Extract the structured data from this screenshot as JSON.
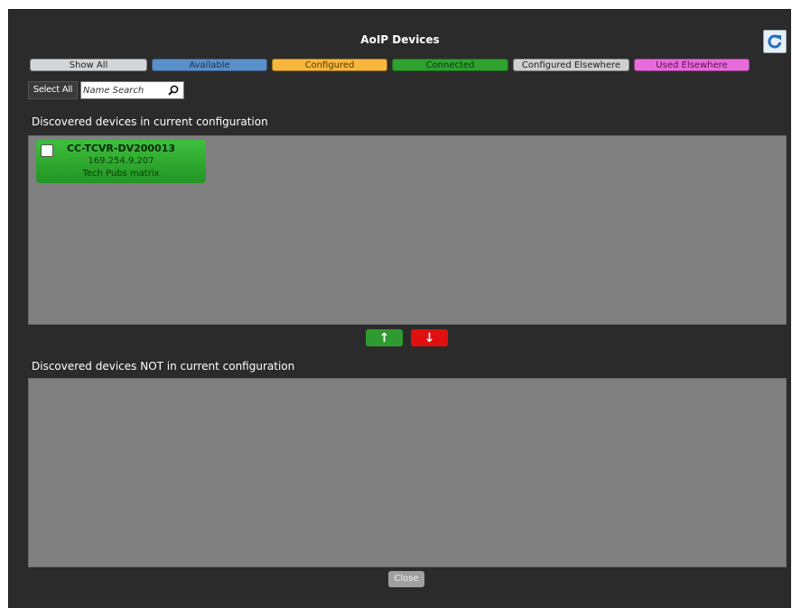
{
  "window": {
    "title": "AoIP Devices"
  },
  "filters": {
    "show_all": "Show All",
    "available": "Available",
    "configured": "Configured",
    "connected": "Connected",
    "configured_elsewhere": "Configured Elsewhere",
    "used_elsewhere": "Used Elsewhere"
  },
  "toolbar": {
    "select_all": "Select All",
    "search_placeholder": "Name Search"
  },
  "sections": {
    "current": "Discovered devices in current configuration",
    "not_current": "Discovered devices NOT in current configuration"
  },
  "devices_current": [
    {
      "name": "CC-TCVR-DV200013",
      "ip": "169.254.9.207",
      "description": "Tech Pubs matrix",
      "status": "Connected",
      "checked": false
    }
  ],
  "devices_not_current": [],
  "buttons": {
    "move_up": "↑",
    "move_down": "↓",
    "close": "Close"
  },
  "icons": {
    "refresh": "refresh-icon",
    "search": "search-icon"
  },
  "colors": {
    "show_all": "#d3d6d9",
    "available": "#5b8fc9",
    "configured": "#f6b73c",
    "connected": "#2fa12f",
    "configured_elsewhere": "#cfcfcf",
    "used_elsewhere": "#e86bdc",
    "move_up": "#2f9a2f",
    "move_down": "#e01010"
  }
}
